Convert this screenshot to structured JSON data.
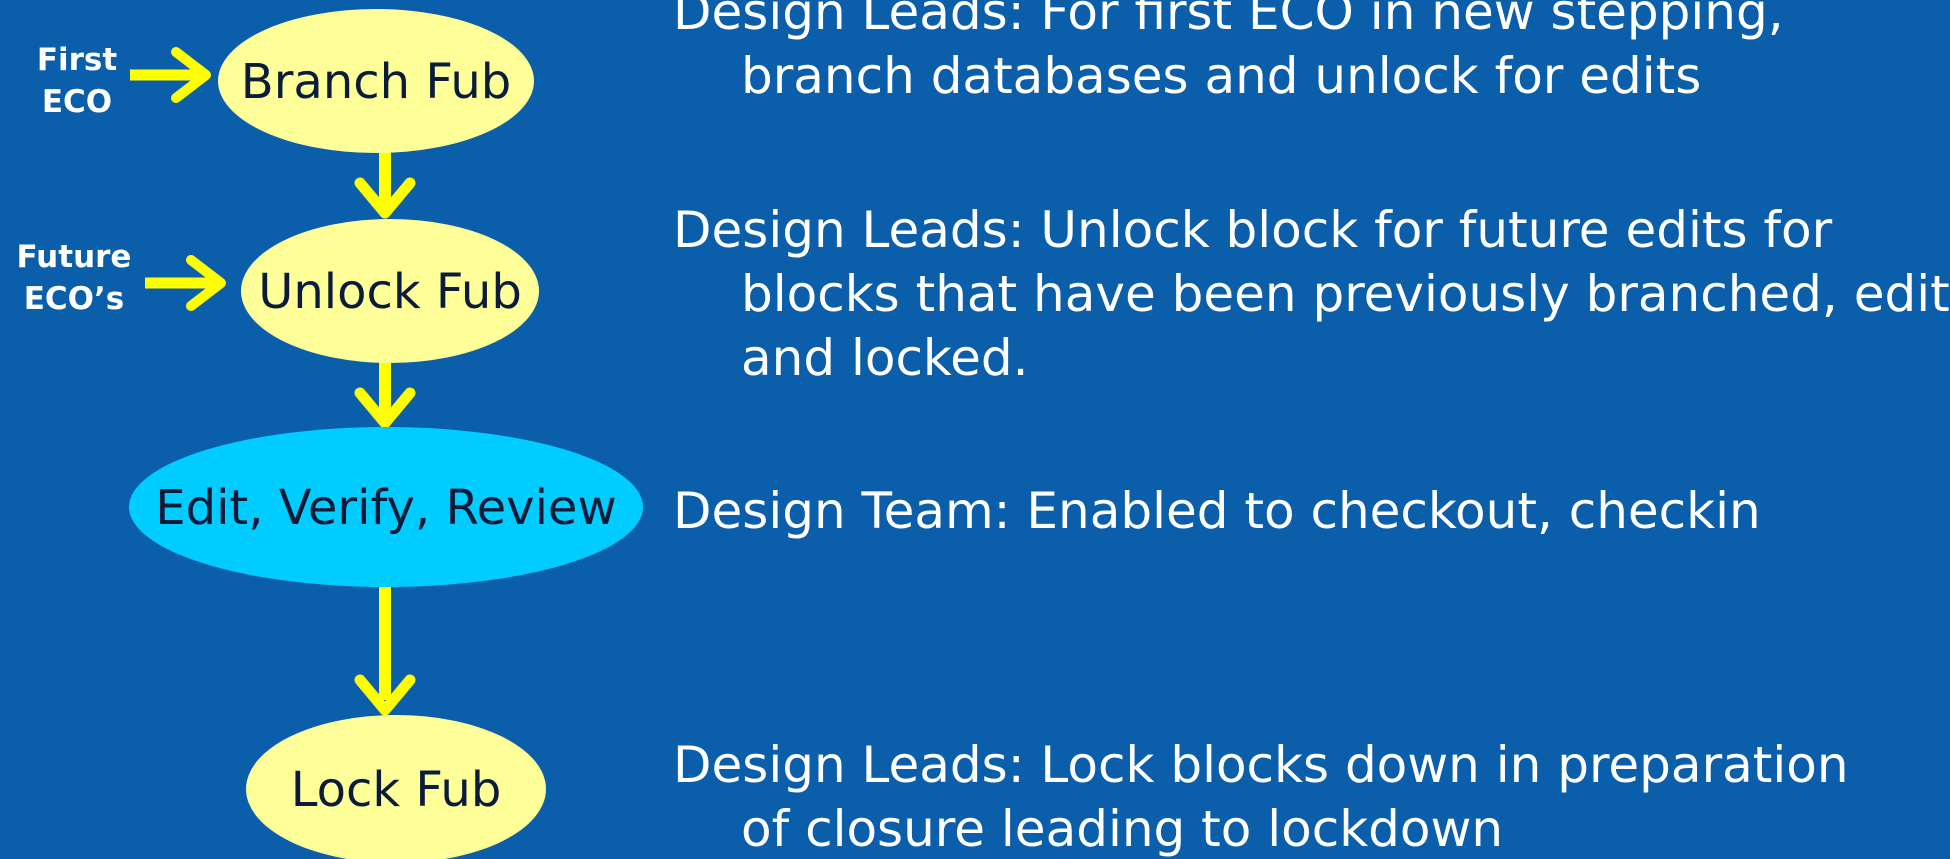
{
  "colors": {
    "background": "#0b5eaa",
    "node_fill": "#ffff99",
    "active_node_fill": "#00ccff",
    "arrow": "#ffff00",
    "node_text": "#0b1c3b",
    "description_text": "#ffffff"
  },
  "nodes": {
    "branch": "Branch Fub",
    "unlock": "Unlock Fub",
    "edit": "Edit, Verify, Review",
    "lock": "Lock Fub"
  },
  "entries": {
    "first": [
      "First",
      "ECO"
    ],
    "future": [
      "Future",
      "ECO’s"
    ]
  },
  "descriptions": {
    "branch": [
      "Design Leads: For first ECO in new stepping,",
      "branch databases and unlock for edits"
    ],
    "unlock": [
      "Design Leads: Unlock block for future edits for",
      "blocks that have been previously branched, edited",
      "and locked."
    ],
    "edit": [
      "Design Team: Enabled to checkout, checkin"
    ],
    "lock": [
      "Design Leads: Lock blocks down in preparation",
      "of closure leading to lockdown"
    ]
  }
}
